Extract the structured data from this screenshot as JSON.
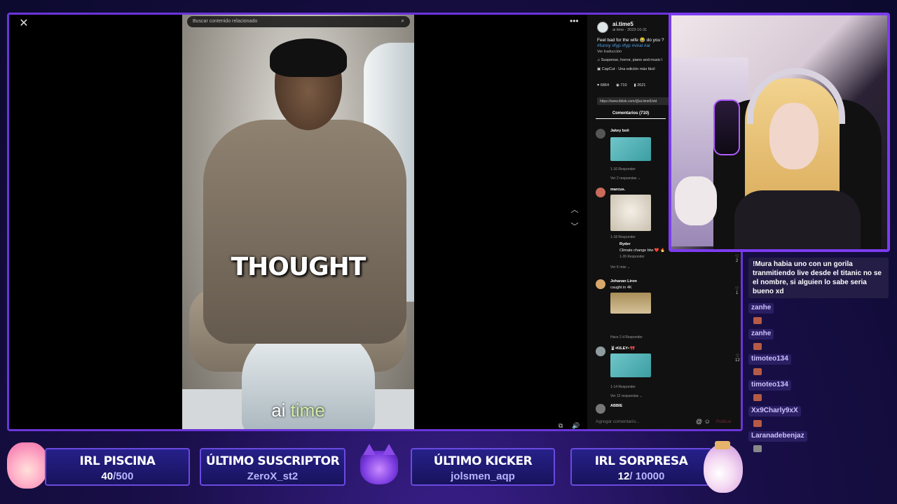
{
  "video": {
    "search_placeholder": "Buscar contenido relacionado",
    "caption": "THOUGHT",
    "watermark_a": "ai ",
    "watermark_b": "time"
  },
  "post": {
    "author": "ai.time5",
    "author_sub": "ai time · 2023-10-31",
    "description": "Feel bad for the wife 😂 do you ?",
    "tags": "#funny #fyp #fyp #viral #ai",
    "translate": "Ver traducción",
    "music": "♫  Suspense, horror, piano and music l",
    "capcut": "CapCut · Una edición más fácil",
    "likes": "6864",
    "comments_count": "710",
    "saves": "2621",
    "url": "https://www.tiktok.com/@ai.time5/vid",
    "comments_tab": "Comentarios (710)"
  },
  "comments": [
    {
      "user": "Jakey boii",
      "meta": "1-16   Responder",
      "more": "Ver 2 respuestas ⌄"
    },
    {
      "user": "marcus.",
      "meta": "1-18   Responder",
      "reply_user": "Ryder",
      "reply_text": "Climate change btw ❤️ 🔥",
      "reply_meta": "1-26   Responder",
      "more": "Ver 6 más ⌄"
    },
    {
      "user": "Johanan Liron",
      "text": "caught in 4K",
      "meta": "Hace 2 d   Responder",
      "likes": "1"
    },
    {
      "user": "🐰•KILEY• 🎀",
      "meta": "1-14   Responder",
      "more": "Ver 12 respuestas ⌄",
      "likes": "12"
    },
    {
      "user": "ABBIE"
    }
  ],
  "marcus_likes": "2",
  "add_comment": "Agregar comentario...",
  "post_btn": "Publicar",
  "chat": {
    "message": "!Mura habia uno con un gorila tranmitiendo live desde el titanic no se el nombre, si alguien lo sabe seria bueno xd",
    "users": [
      "zanhe",
      "zanhe",
      "timoteo134",
      "timoteo134",
      "Xx9Charly9xX",
      "Laranadebenjaz"
    ]
  },
  "widgets": {
    "piscina_title": "IRL PISCINA",
    "piscina_current": "40",
    "piscina_goal": "/500",
    "suscriptor_title": "ÚLTIMO SUSCRIPTOR",
    "suscriptor_name": "ZeroX_st2",
    "kicker_title": "ÚLTIMO KICKER",
    "kicker_name": "jolsmen_aqp",
    "sorpresa_title": "IRL SORPRESA",
    "sorpresa_current": "12",
    "sorpresa_goal": "/ 10000"
  },
  "colors": {
    "frame_border": "#6b35d9",
    "webcam_border": "#7c3cf0",
    "widget_bg": "#26208a",
    "tag_blue": "#4f9fe6"
  }
}
